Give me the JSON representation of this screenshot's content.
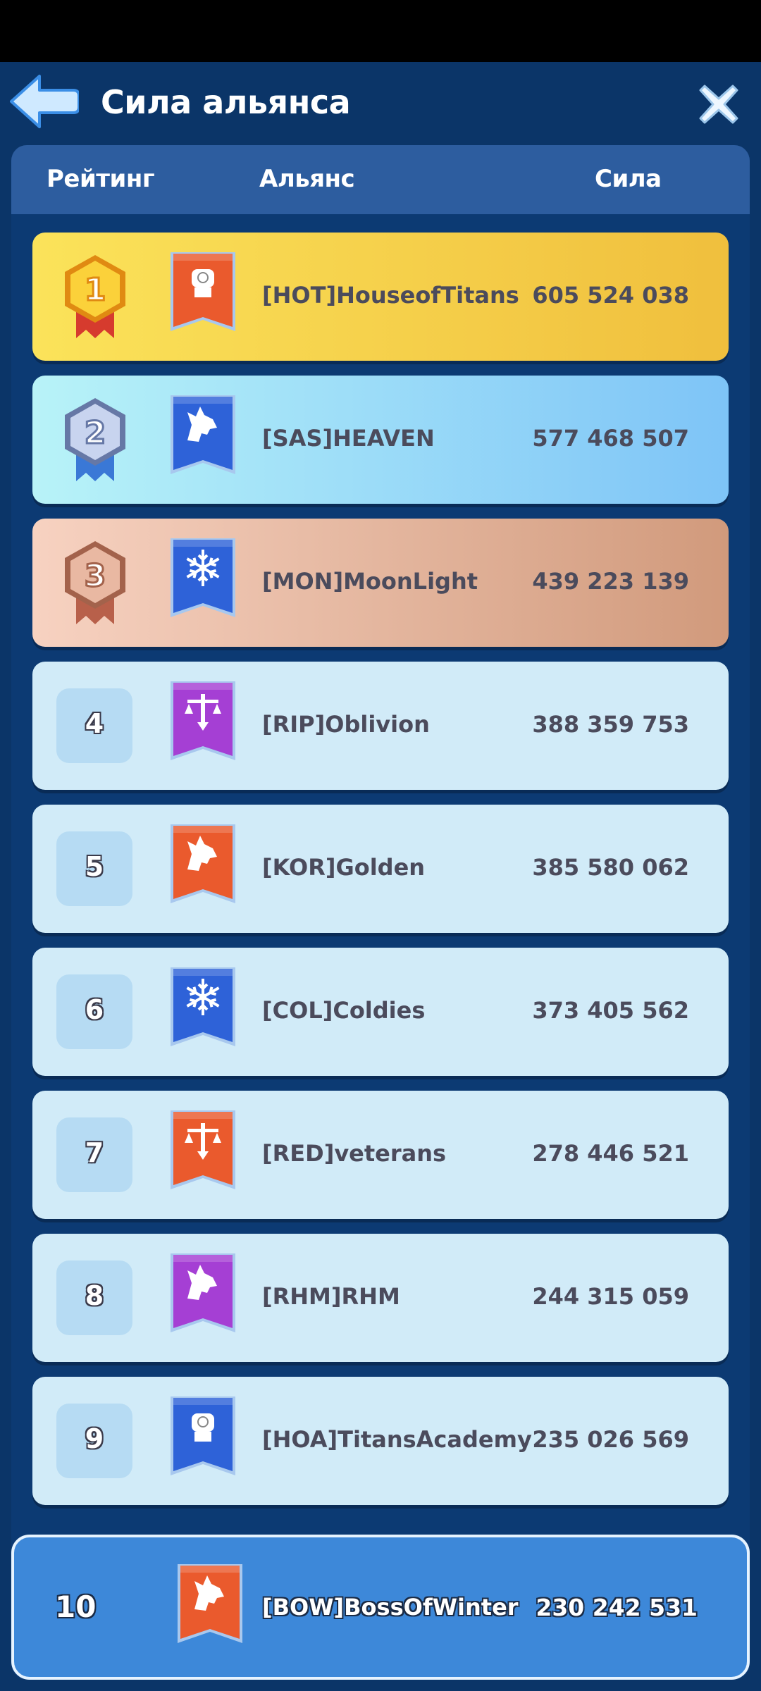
{
  "header": {
    "title": "Сила альянса"
  },
  "columns": {
    "rank": "Рейтинг",
    "alliance": "Альянс",
    "power": "Сила"
  },
  "rows": [
    {
      "rank": "1",
      "name": "[HOT]HouseofTitans",
      "power": "605 524 038",
      "emblem": "fist-icon",
      "banner_color": "#ea5a2d",
      "style": "gold"
    },
    {
      "rank": "2",
      "name": "[SAS]HEAVEN",
      "power": "577 468 507",
      "emblem": "wolf-icon",
      "banner_color": "#2e62d8",
      "style": "silver"
    },
    {
      "rank": "3",
      "name": "[MON]MoonLight",
      "power": "439 223 139",
      "emblem": "snowflake-icon",
      "banner_color": "#2e62d8",
      "style": "bronze"
    },
    {
      "rank": "4",
      "name": "[RIP]Oblivion",
      "power": "388 359 753",
      "emblem": "scales-icon",
      "banner_color": "#a53fd4",
      "style": "plain"
    },
    {
      "rank": "5",
      "name": "[KOR]Golden",
      "power": "385 580 062",
      "emblem": "wolf-icon",
      "banner_color": "#ea5a2d",
      "style": "plain"
    },
    {
      "rank": "6",
      "name": "[COL]Coldies",
      "power": "373 405 562",
      "emblem": "snowflake-icon",
      "banner_color": "#2e62d8",
      "style": "plain"
    },
    {
      "rank": "7",
      "name": "[RED]veterans",
      "power": "278 446 521",
      "emblem": "scales-icon",
      "banner_color": "#ea5a2d",
      "style": "plain"
    },
    {
      "rank": "8",
      "name": "[RHM]RHM",
      "power": "244 315 059",
      "emblem": "wolf-icon",
      "banner_color": "#a53fd4",
      "style": "plain"
    },
    {
      "rank": "9",
      "name": "[HOA]TitansAcademy",
      "power": "235 026 569",
      "emblem": "fist-icon",
      "banner_color": "#2e62d8",
      "style": "plain"
    }
  ],
  "my_alliance": {
    "rank": "10",
    "name": "[BOW]BossOfWinter",
    "power": "230 242 531",
    "emblem": "wolf-icon",
    "banner_color": "#ea5a2d"
  }
}
